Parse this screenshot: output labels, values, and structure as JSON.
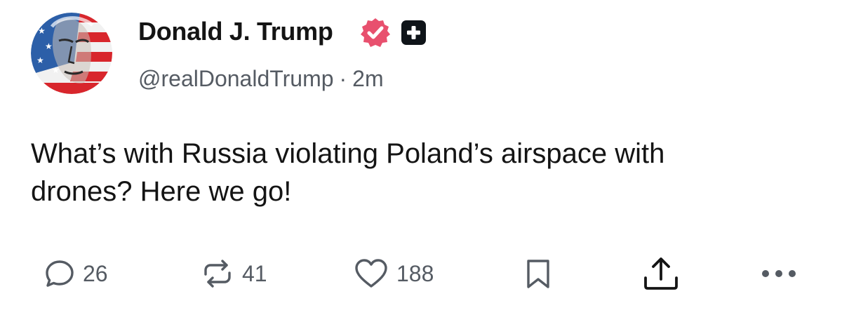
{
  "author": {
    "display_name": "Donald J. Trump",
    "handle": "@realDonaldTrump",
    "separator": "·",
    "time_ago": "2m"
  },
  "badges": {
    "verified_icon": "verified-badge-icon",
    "verified_color": "#e8506e",
    "plus_icon": "plus-badge-icon",
    "plus_color": "#0f1419"
  },
  "post": {
    "text": "What’s with Russia violating Poland’s airspace with\ndrones? Here we go!"
  },
  "actions": {
    "reply": {
      "icon": "reply-icon",
      "count": "26"
    },
    "repost": {
      "icon": "repost-icon",
      "count": "41"
    },
    "like": {
      "icon": "heart-icon",
      "count": "188"
    },
    "bookmark": {
      "icon": "bookmark-icon"
    },
    "share": {
      "icon": "share-icon"
    },
    "more": {
      "icon": "more-icon"
    }
  },
  "colors": {
    "text_primary": "#141414",
    "text_secondary": "#555b63",
    "icon": "#555b63"
  }
}
